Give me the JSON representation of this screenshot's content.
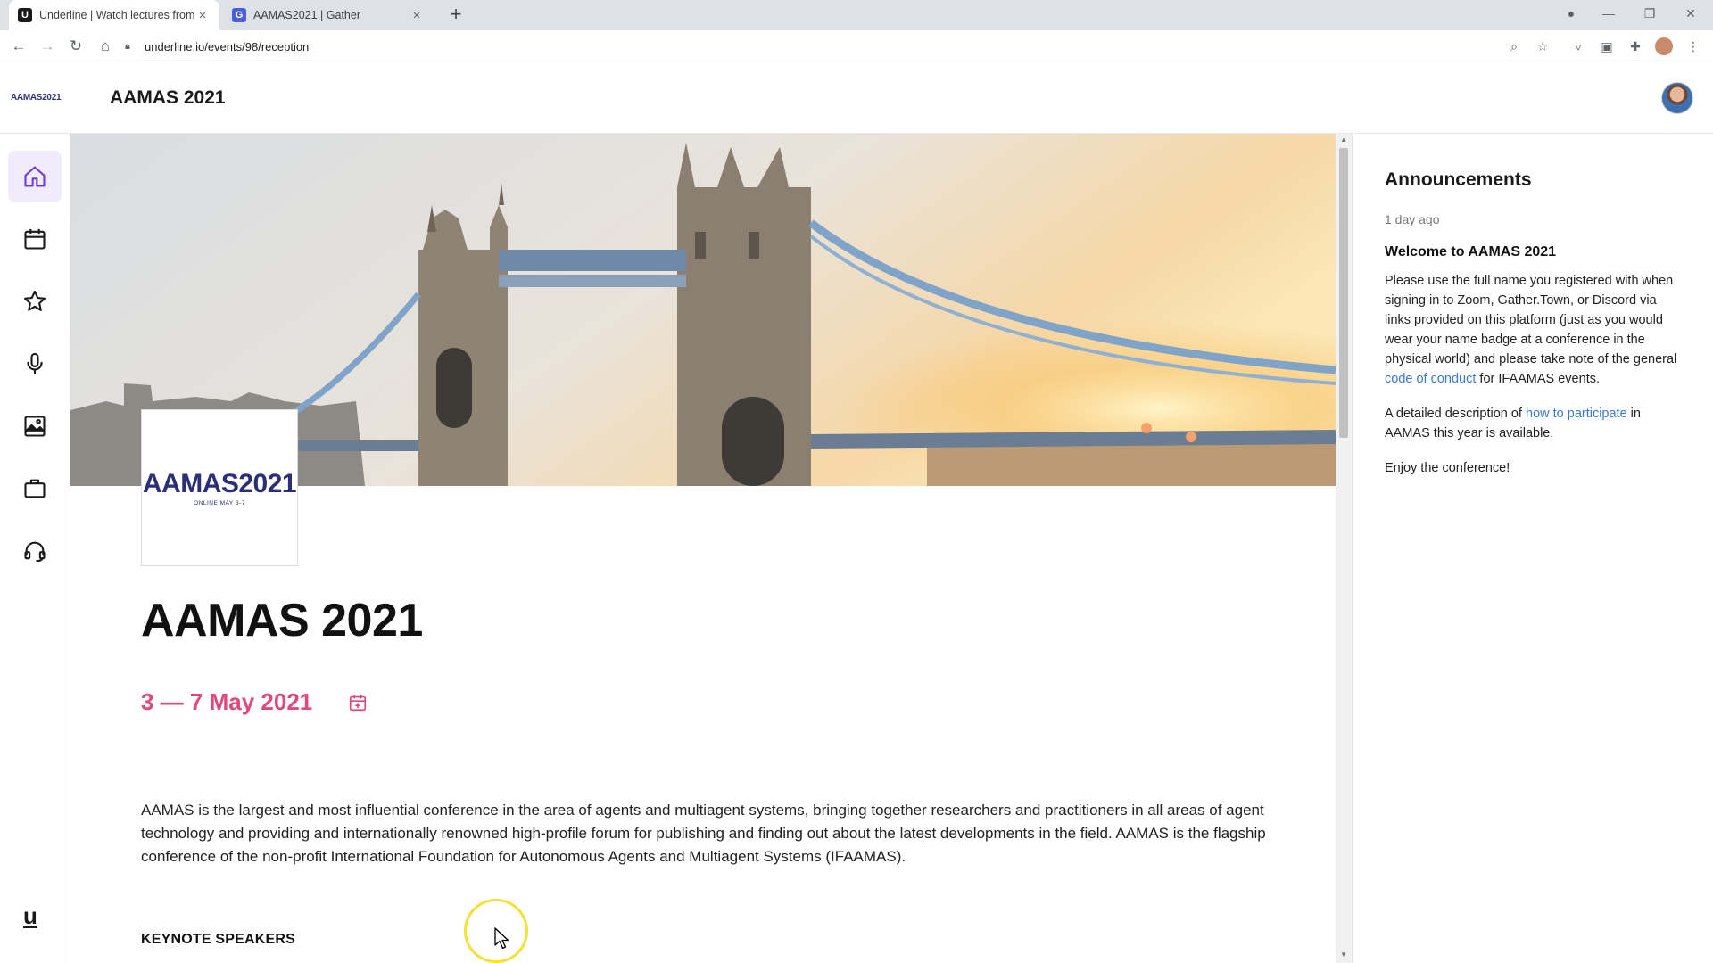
{
  "browser": {
    "tabs": [
      {
        "title": "Underline | Watch lectures from t",
        "favicon": "U",
        "active": true,
        "close": "×"
      },
      {
        "title": "AAMAS2021 | Gather",
        "favicon": "G",
        "active": false,
        "close": "×"
      }
    ],
    "new_tab": "+",
    "url": "underline.io/events/98/reception"
  },
  "header": {
    "logo_text": "AAMAS2021",
    "event_title": "AAMAS 2021"
  },
  "sidebar": {
    "items": [
      {
        "name": "home",
        "icon": "home-icon",
        "active": true
      },
      {
        "name": "schedule",
        "icon": "calendar-icon",
        "active": false
      },
      {
        "name": "favorites",
        "icon": "star-icon",
        "active": false
      },
      {
        "name": "talks",
        "icon": "microphone-icon",
        "active": false
      },
      {
        "name": "posters",
        "icon": "image-icon",
        "active": false
      },
      {
        "name": "expo",
        "icon": "briefcase-icon",
        "active": false
      },
      {
        "name": "support",
        "icon": "headset-icon",
        "active": false
      }
    ],
    "footer_logo": "u"
  },
  "main": {
    "logo_card": {
      "line1": "AAMAS2021",
      "line2": "ONLINE MAY 3-7"
    },
    "headline": "AAMAS 2021",
    "dates": "3 — 7 May 2021",
    "description": "AAMAS is the largest and most influential conference in the area of agents and multiagent systems, bringing together researchers and practitioners in all areas of agent technology and providing and internationally renowned high-profile forum for publishing and finding out about the latest developments in the field. AAMAS is the flagship conference of the non-profit International Foundation for Autonomous Agents and Multiagent Systems (IFAAMAS).",
    "section_title": "KEYNOTE SPEAKERS"
  },
  "announcements": {
    "heading": "Announcements",
    "items": [
      {
        "time": "1 day ago",
        "title": "Welcome to AAMAS 2021",
        "p1_before": "Please use the full name you registered with when signing in to Zoom, Gather.Town, or Discord via links provided on this platform (just as you would wear your name badge at a conference in the physical world) and please take note of the general ",
        "p1_link": "code of conduct",
        "p1_after": " for IFAAMAS events.",
        "p2_before": "A detailed description of ",
        "p2_link": "how to participate",
        "p2_after": " in AAMAS this year is available.",
        "p3": "Enjoy the conference!"
      }
    ]
  },
  "colors": {
    "accent_pink": "#e0477a",
    "accent_purple": "#6b3fd6",
    "link_blue": "#3a7bc8"
  }
}
